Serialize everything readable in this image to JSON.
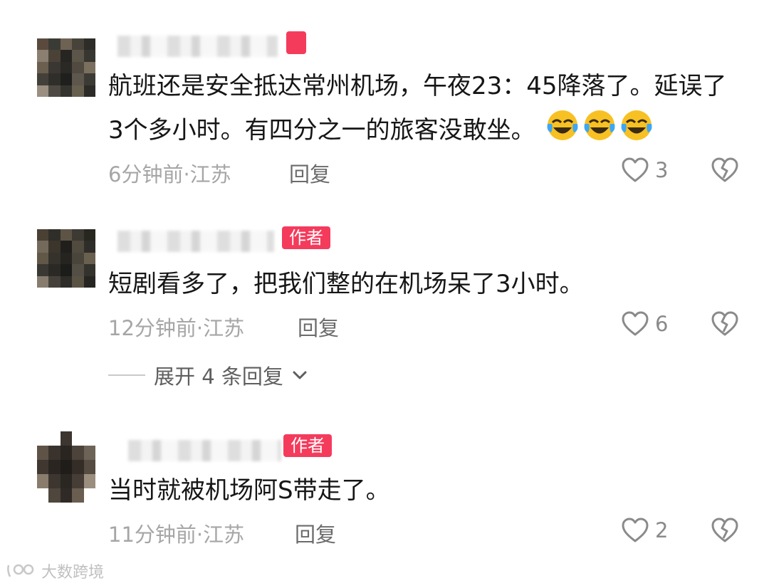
{
  "author_tag": "作者",
  "comments": [
    {
      "text": "航班还是安全抵达常州机场，午夜23：45降落了。延误了3个多小时。有四分之一的旅客没敢坐。",
      "emoji_icon": "face-with-tears-of-joy-icon",
      "emoji_count": 3,
      "time": "6分钟前·江苏",
      "reply": "回复",
      "likes": "3"
    },
    {
      "text": "短剧看多了，把我们整的在机场呆了3小时。",
      "time": "12分钟前·江苏",
      "reply": "回复",
      "likes": "6",
      "expand": "展开 4 条回复"
    },
    {
      "text": "当时就被机场阿S带走了。",
      "time": "11分钟前·江苏",
      "reply": "回复",
      "likes": "2"
    }
  ],
  "watermark": "大数跨境",
  "colors": {
    "author_tag": "#f43b5c",
    "text": "#161616",
    "meta": "#a6a6a6",
    "reply": "#6b6b6b"
  }
}
